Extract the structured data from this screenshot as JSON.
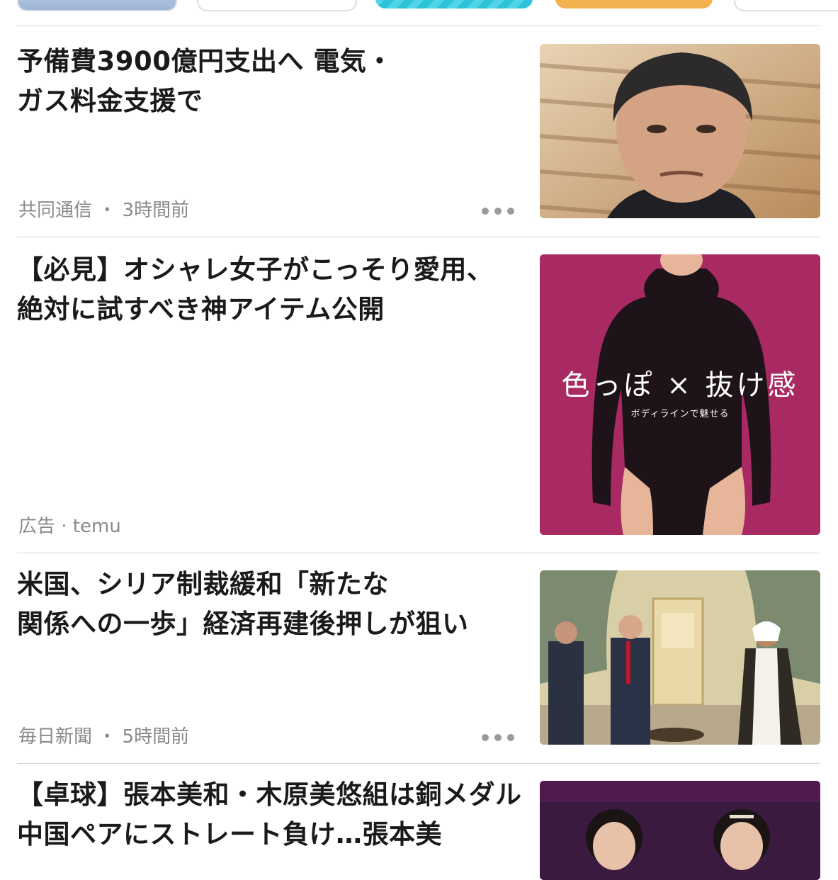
{
  "articles": [
    {
      "title_line1": "予備費3900億円支出へ 電気・",
      "title_line2": "ガス料金支援で",
      "source": "共同通信",
      "time": "3時間前",
      "thumbnail": "photo-portrait-man"
    },
    {
      "title_line1": "【必見】オシャレ女子がこっそり愛用、",
      "title_line2": "絶対に試すべき神アイテム公開",
      "ad_label": "広告 · temu",
      "thumbnail_text_main": "色っぽ × 抜け感",
      "thumbnail_text_sub": "ボディラインで魅せる",
      "thumbnail_bg": "#a92a62"
    },
    {
      "title_line1": "米国、シリア制裁緩和「新たな",
      "title_line2": "関係への一歩」経済再建後押しが狙い",
      "source": "毎日新聞",
      "time": "5時間前",
      "thumbnail": "photo-meeting-room"
    },
    {
      "title_line1": "【卓球】張本美和・木原美悠組は銅メダル",
      "title_line2": "中国ペアにストレート負け…張本美",
      "thumbnail_bg": "#3a1a3f"
    }
  ],
  "meta_separator": " ・ ",
  "more_icon": "ellipsis-horizontal"
}
